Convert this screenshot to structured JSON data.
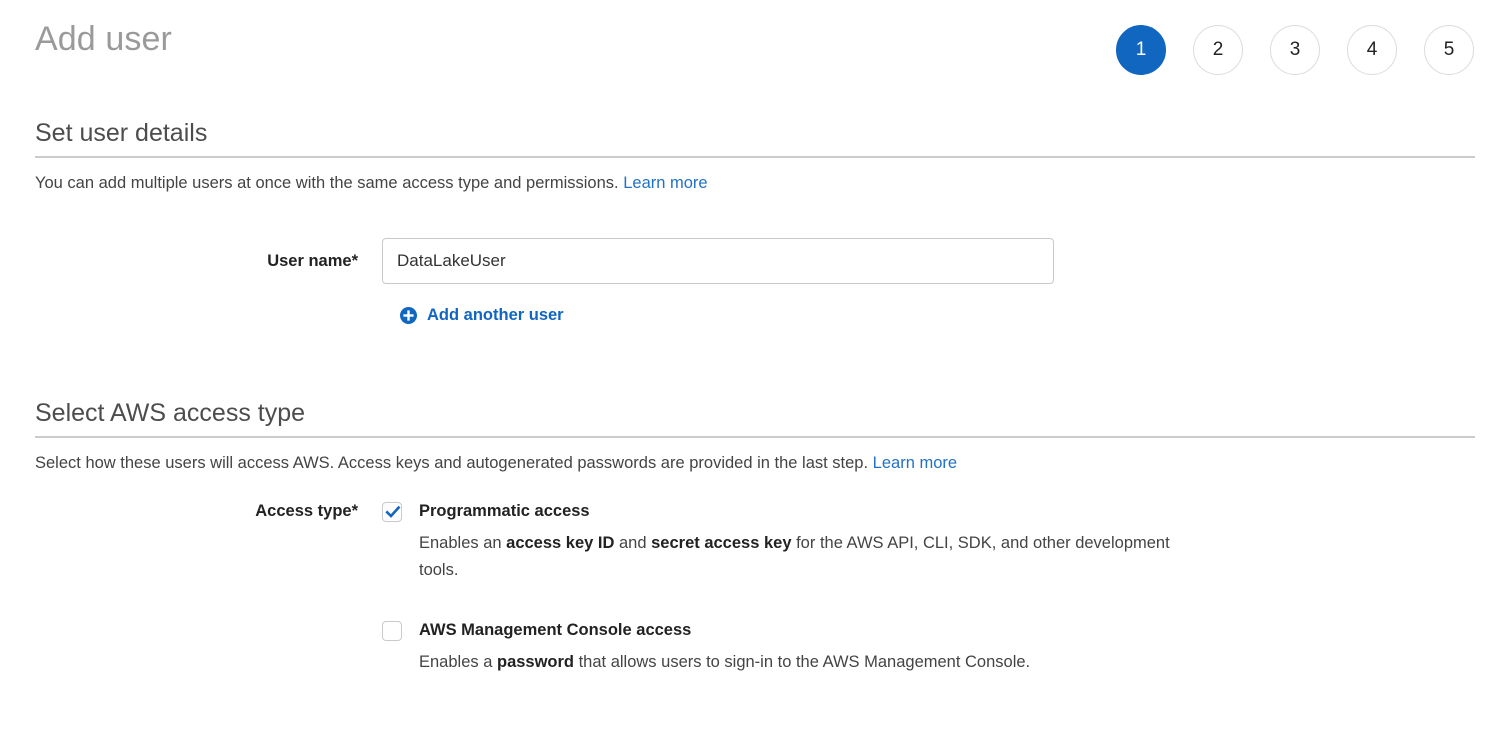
{
  "header": {
    "title": "Add user",
    "steps": [
      {
        "label": "1",
        "active": true
      },
      {
        "label": "2",
        "active": false
      },
      {
        "label": "3",
        "active": false
      },
      {
        "label": "4",
        "active": false
      },
      {
        "label": "5",
        "active": false
      }
    ]
  },
  "colors": {
    "accent_blue": "#1166c0",
    "link_blue": "#2272c4",
    "title_gray": "#9a9a9a",
    "rule_gray": "#cccccc",
    "border_gray": "#c9c9c9"
  },
  "user_details": {
    "section_title": "Set user details",
    "description": "You can add multiple users at once with the same access type and permissions.",
    "learn_more": "Learn more",
    "user_name_label": "User name*",
    "user_name_value": "DataLakeUser",
    "user_name_placeholder": "",
    "add_another_user": "Add another user",
    "add_icon": "plus-circle-icon"
  },
  "access_type": {
    "section_title": "Select AWS access type",
    "description": "Select how these users will access AWS. Access keys and autogenerated passwords are provided in the last step.",
    "learn_more": "Learn more",
    "access_type_label": "Access type*",
    "options": [
      {
        "title": "Programmatic access",
        "checked": true,
        "desc_part1": "Enables an ",
        "desc_bold1": "access key ID",
        "desc_part2": " and ",
        "desc_bold2": "secret access key",
        "desc_part3": " for the AWS API, CLI, SDK, and other development tools."
      },
      {
        "title": "AWS Management Console access",
        "checked": false,
        "desc_part1": "Enables a ",
        "desc_bold1": "password",
        "desc_part2": " that allows users to sign-in to the AWS Management Console.",
        "desc_bold2": "",
        "desc_part3": ""
      }
    ]
  }
}
